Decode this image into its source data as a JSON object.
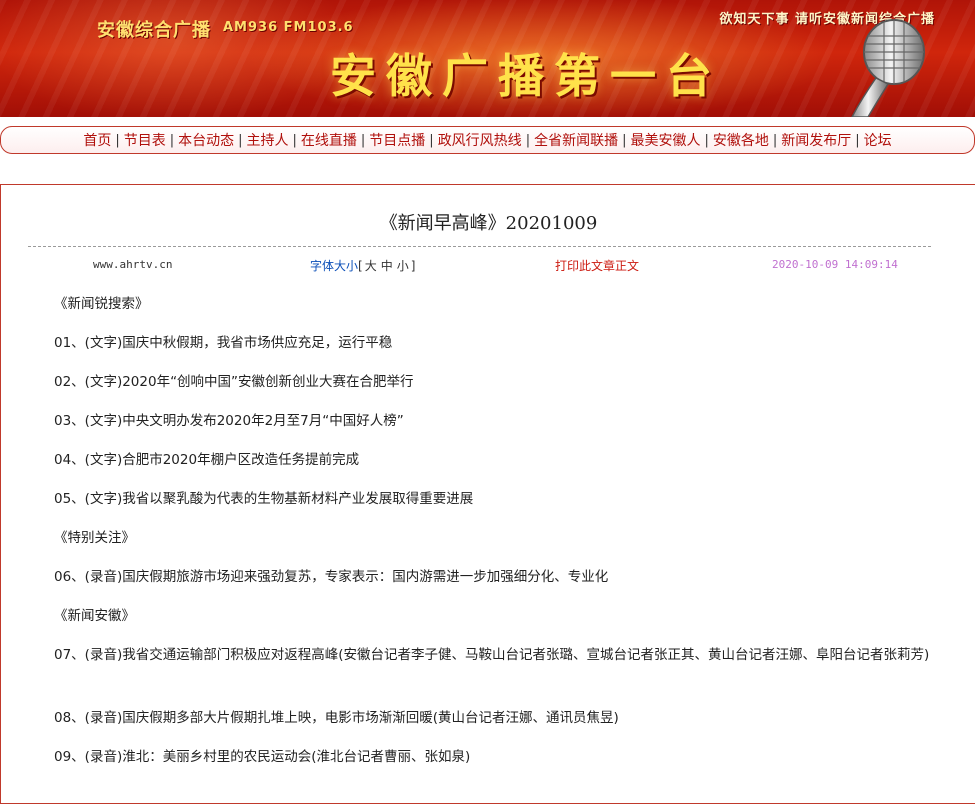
{
  "banner": {
    "station_name": "安徽综合广播",
    "frequencies": "AM936 FM103.6",
    "slogan": "欲知天下事 请听安徽新闻综合广播",
    "title": "安徽广播第一台"
  },
  "nav": {
    "items": [
      "首页",
      "节目表",
      "本台动态",
      "主持人",
      "在线直播",
      "节目点播",
      "政风行风热线",
      "全省新闻联播",
      "最美安徽人",
      "安徽各地",
      "新闻发布厅",
      "论坛"
    ],
    "separator": "|"
  },
  "article": {
    "title": "《新闻早高峰》20201009",
    "site": "www.ahrtv.cn",
    "font_size_label": "字体大小",
    "font_sizes": [
      "大",
      "中",
      "小"
    ],
    "print_label": "打印此文章正文",
    "timestamp": "2020-10-09 14:09:14",
    "lines": [
      "《新闻锐搜索》",
      "01、(文字)国庆中秋假期，我省市场供应充足，运行平稳",
      "02、(文字)2020年“创响中国”安徽创新创业大赛在合肥举行",
      "03、(文字)中央文明办发布2020年2月至7月“中国好人榜”",
      "04、(文字)合肥市2020年棚户区改造任务提前完成",
      "05、(文字)我省以聚乳酸为代表的生物基新材料产业发展取得重要进展",
      "《特别关注》",
      "06、(录音)国庆假期旅游市场迎来强劲复苏，专家表示：国内游需进一步加强细分化、专业化",
      "《新闻安徽》",
      "07、(录音)我省交通运输部门积极应对返程高峰(安徽台记者李子健、马鞍山台记者张璐、宣城台记者张正其、黄山台记者汪娜、阜阳台记者张莉芳)",
      "08、(录音)国庆假期多部大片假期扎堆上映，电影市场渐渐回暖(黄山台记者汪娜、通讯员焦昱)",
      "09、(录音)淮北：美丽乡村里的农民运动会(淮北台记者曹丽、张如泉)"
    ]
  },
  "colors": {
    "banner_red": "#c41e0a",
    "title_gold": "#ffe24a",
    "nav_link": "#b0100c",
    "frame_border": "#c0392b",
    "link_blue": "#0b4fb8",
    "print_red": "#cc1a10",
    "timestamp_purple": "#c070d0"
  }
}
